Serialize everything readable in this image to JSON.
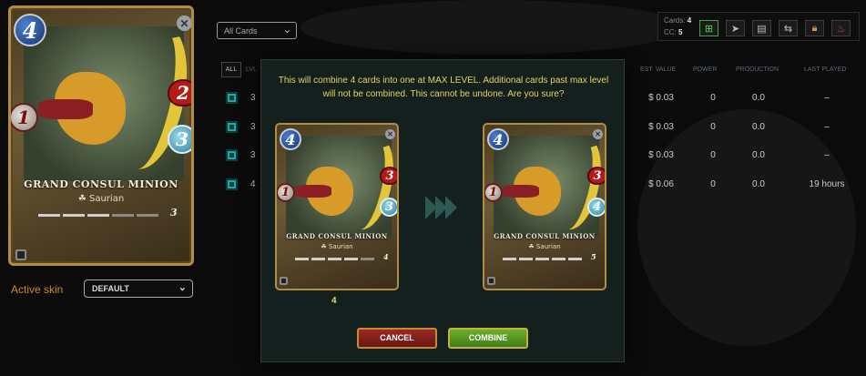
{
  "left_card": {
    "mana": "4",
    "attack": "1",
    "health": "2",
    "speed": "3",
    "name": "GRAND CONSUL MINION",
    "type": "Saurian",
    "level": "3"
  },
  "active_skin": {
    "label": "Active skin",
    "value": "DEFAULT"
  },
  "filter": {
    "value": "All Cards"
  },
  "info": {
    "cards_label": "Cards:",
    "cards_value": "4",
    "cc_label": "CC:",
    "cc_value": "5"
  },
  "table": {
    "all_label": "ALL",
    "lvl_header": "LVL",
    "headers": [
      "EST. VALUE",
      "POWER",
      "PRODUCTION",
      "LAST PLAYED"
    ],
    "rows": [
      {
        "lvl": "3",
        "value": "$ 0.03",
        "power": "0",
        "production": "0.0",
        "last_played": "–"
      },
      {
        "lvl": "3",
        "value": "$ 0.03",
        "power": "0",
        "production": "0.0",
        "last_played": "–"
      },
      {
        "lvl": "3",
        "value": "$ 0.03",
        "power": "0",
        "production": "0.0",
        "last_played": "–"
      },
      {
        "lvl": "4",
        "value": "$ 0.06",
        "power": "0",
        "production": "0.0",
        "last_played": "19 hours"
      }
    ]
  },
  "modal": {
    "message": "This will combine 4 cards into one at MAX LEVEL. Additional cards past max level will not be combined. This cannot be undone. Are you sure?",
    "before_card": {
      "mana": "4",
      "attack": "1",
      "health": "3",
      "speed": "3",
      "name": "GRAND CONSUL MINION",
      "type": "Saurian",
      "level": "4"
    },
    "after_card": {
      "mana": "4",
      "attack": "1",
      "health": "3",
      "speed": "4",
      "name": "GRAND CONSUL MINION",
      "type": "Saurian",
      "level": "5"
    },
    "count": "4",
    "cancel_label": "CANCEL",
    "combine_label": "COMBINE"
  },
  "colors": {
    "accent_gold": "#e4d468",
    "skin_label": "#d08a1a",
    "card_border": "#b08d42",
    "combine_green": "#6cb02c",
    "cancel_red": "#9a2a22",
    "checkbox_teal": "#1fa6a6"
  }
}
